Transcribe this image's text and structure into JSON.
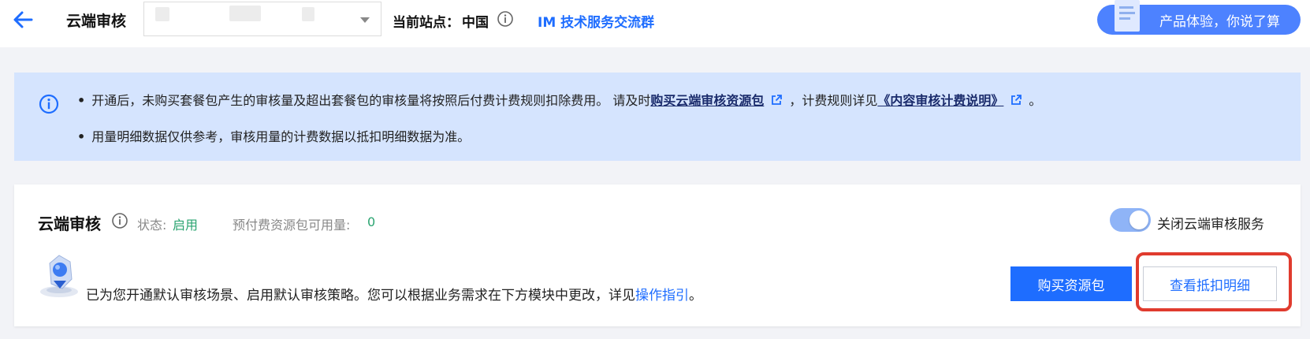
{
  "header": {
    "title": "云端审核",
    "site_label": "当前站点：",
    "site_value": "中国",
    "im_link": "IM 技术服务交流群",
    "feedback_text": "产品体验，你说了算"
  },
  "notice": {
    "line1_prefix": "开通后，未购买套餐包产生的审核量及超出套餐包的审核量将按照后付费计费规则扣除费用。 请及时",
    "line1_link1": "购买云端审核资源包",
    "line1_middle": "，计费规则详见",
    "line1_link2": "《内容审核计费说明》",
    "line1_suffix": "。",
    "line2": "用量明细数据仅供参考，审核用量的计费数据以抵扣明细数据为准。"
  },
  "card": {
    "title": "云端审核",
    "status_label": "状态:",
    "status_value": "启用",
    "prepaid_label": "预付费资源包可用量:",
    "prepaid_value": "0",
    "toggle_label": "关闭云端审核服务",
    "toggle_on": true,
    "description": "已为您开通默认审核场景、启用默认审核策略。您可以根据业务需求在下方模块中更改，详见",
    "guide_link": "操作指引",
    "description_suffix": "。",
    "buy_button": "购买资源包",
    "detail_button": "查看抵扣明细"
  },
  "colors": {
    "accent": "#1e6dff",
    "status_green": "#2ba471",
    "notice_bg": "#d5e4fe",
    "highlight_red": "#e03b2e"
  }
}
